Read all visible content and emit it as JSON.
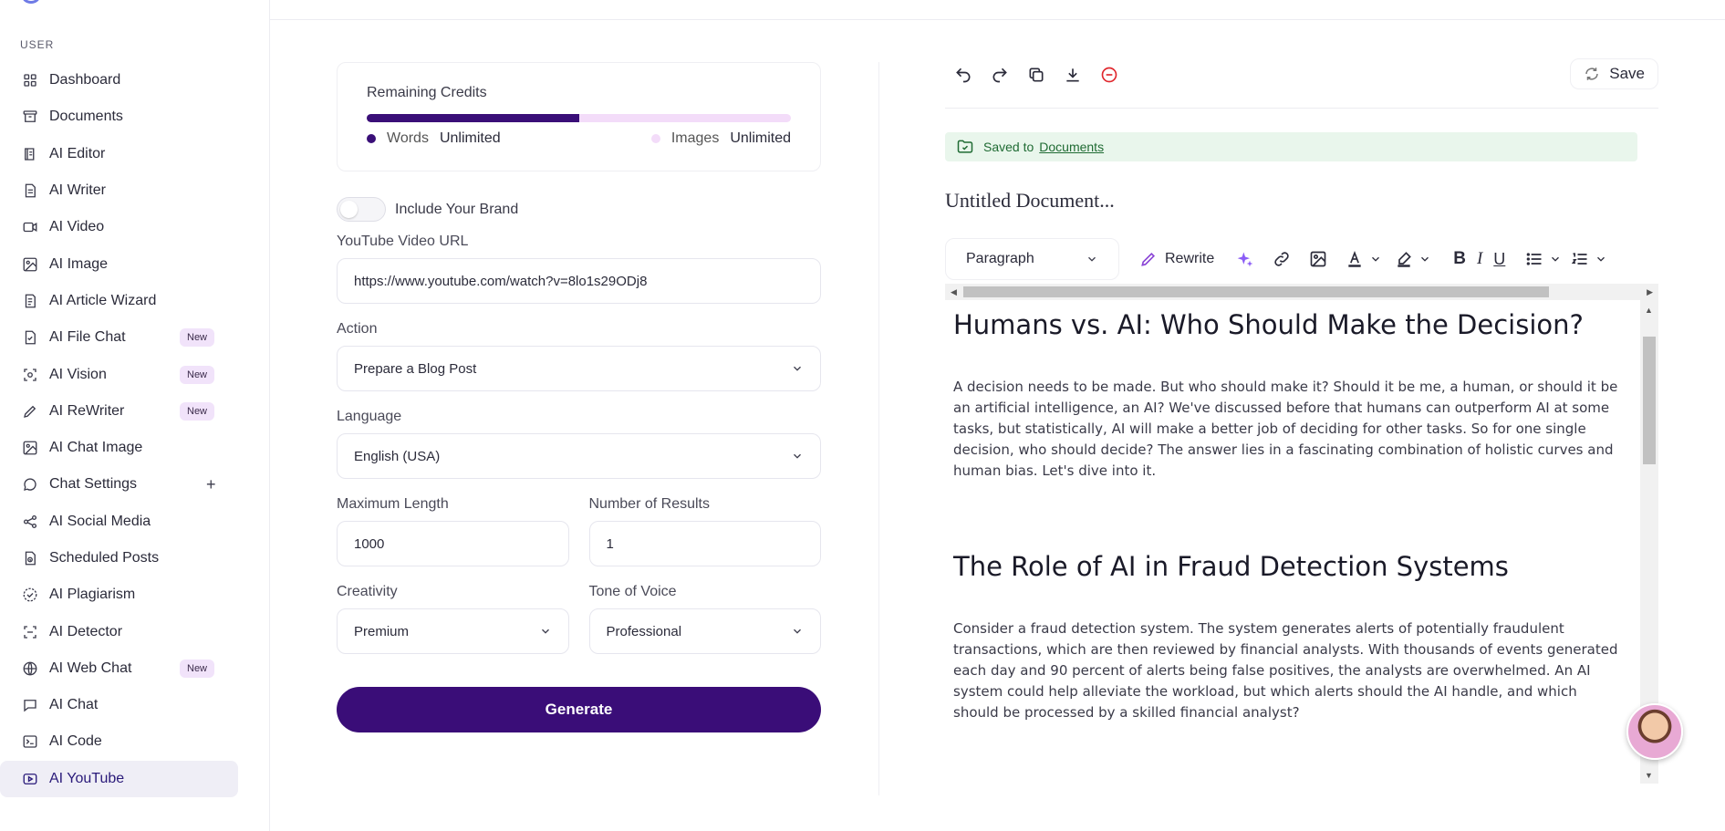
{
  "sidebar": {
    "section_title": "USER",
    "items": [
      {
        "label": "Dashboard",
        "icon": "grid-icon"
      },
      {
        "label": "Documents",
        "icon": "archive-icon"
      },
      {
        "label": "AI Editor",
        "icon": "book-icon"
      },
      {
        "label": "AI Writer",
        "icon": "file-text-icon"
      },
      {
        "label": "AI Video",
        "icon": "video-icon"
      },
      {
        "label": "AI Image",
        "icon": "image-icon"
      },
      {
        "label": "AI Article Wizard",
        "icon": "wizard-icon"
      },
      {
        "label": "AI File Chat",
        "icon": "file-chat-icon",
        "badge": "New"
      },
      {
        "label": "AI Vision",
        "icon": "scan-icon",
        "badge": "New"
      },
      {
        "label": "AI ReWriter",
        "icon": "pen-icon",
        "badge": "New"
      },
      {
        "label": "AI Chat Image",
        "icon": "image-icon"
      },
      {
        "label": "Chat Settings",
        "icon": "chat-bubble-icon",
        "plus": "+"
      },
      {
        "label": "AI Social Media",
        "icon": "share-icon"
      },
      {
        "label": "Scheduled Posts",
        "icon": "calendar-icon"
      },
      {
        "label": "AI Plagiarism",
        "icon": "check-circle-icon"
      },
      {
        "label": "AI Detector",
        "icon": "detector-icon"
      },
      {
        "label": "AI Web Chat",
        "icon": "www-icon",
        "badge": "New"
      },
      {
        "label": "AI Chat",
        "icon": "chat-icon"
      },
      {
        "label": "AI Code",
        "icon": "terminal-icon"
      },
      {
        "label": "AI YouTube",
        "icon": "youtube-icon",
        "active": true
      }
    ]
  },
  "credits": {
    "title": "Remaining Credits",
    "words_label": "Words",
    "words_value": "Unlimited",
    "images_label": "Images",
    "images_value": "Unlimited",
    "words_fill": 0.5,
    "words_color": "#3a0f78",
    "images_color": "#f3dcf9"
  },
  "form": {
    "brand_toggle_label": "Include Your Brand",
    "brand_toggle_on": false,
    "url_label": "YouTube Video URL",
    "url_value": "https://www.youtube.com/watch?v=8lo1s29ODj8",
    "action_label": "Action",
    "action_value": "Prepare a Blog Post",
    "language_label": "Language",
    "language_value": "English (USA)",
    "max_length_label": "Maximum Length",
    "max_length_value": "1000",
    "results_label": "Number of Results",
    "results_value": "1",
    "creativity_label": "Creativity",
    "creativity_value": "Premium",
    "tone_label": "Tone of Voice",
    "tone_value": "Professional",
    "generate_label": "Generate"
  },
  "editor": {
    "save_label": "Save",
    "saved_text": "Saved to",
    "saved_link": "Documents",
    "doc_title": "Untitled Document...",
    "paragraph_select": "Paragraph",
    "rewrite_label": "Rewrite",
    "heading1": "Humans vs. AI: Who Should Make the Decision?",
    "para1": "A decision needs to be made. But who should make it? Should it be me, a human, or should it be an artificial intelligence, an AI? We've discussed before that humans can outperform AI at some tasks, but statistically, AI will make a better job of deciding for other tasks. So for one single decision, who should decide? The answer lies in a fascinating combination of holistic curves and human bias. Let's dive into it.",
    "heading2": "The Role of AI in Fraud Detection Systems",
    "para2": "Consider a fraud detection system. The system generates alerts of potentially fraudulent transactions, which are then reviewed by financial analysts. With thousands of events generated each day and 90 percent of alerts being false positives, the analysts are overwhelmed. An AI system could help alleviate the workload, but which alerts should the AI handle, and which should be processed by a skilled financial analyst?"
  },
  "colors": {
    "primary": "#3a0d78",
    "saved_bg": "#e9f6ec",
    "badge_bg": "#f1e3fa",
    "delete_red": "#e0282e"
  }
}
